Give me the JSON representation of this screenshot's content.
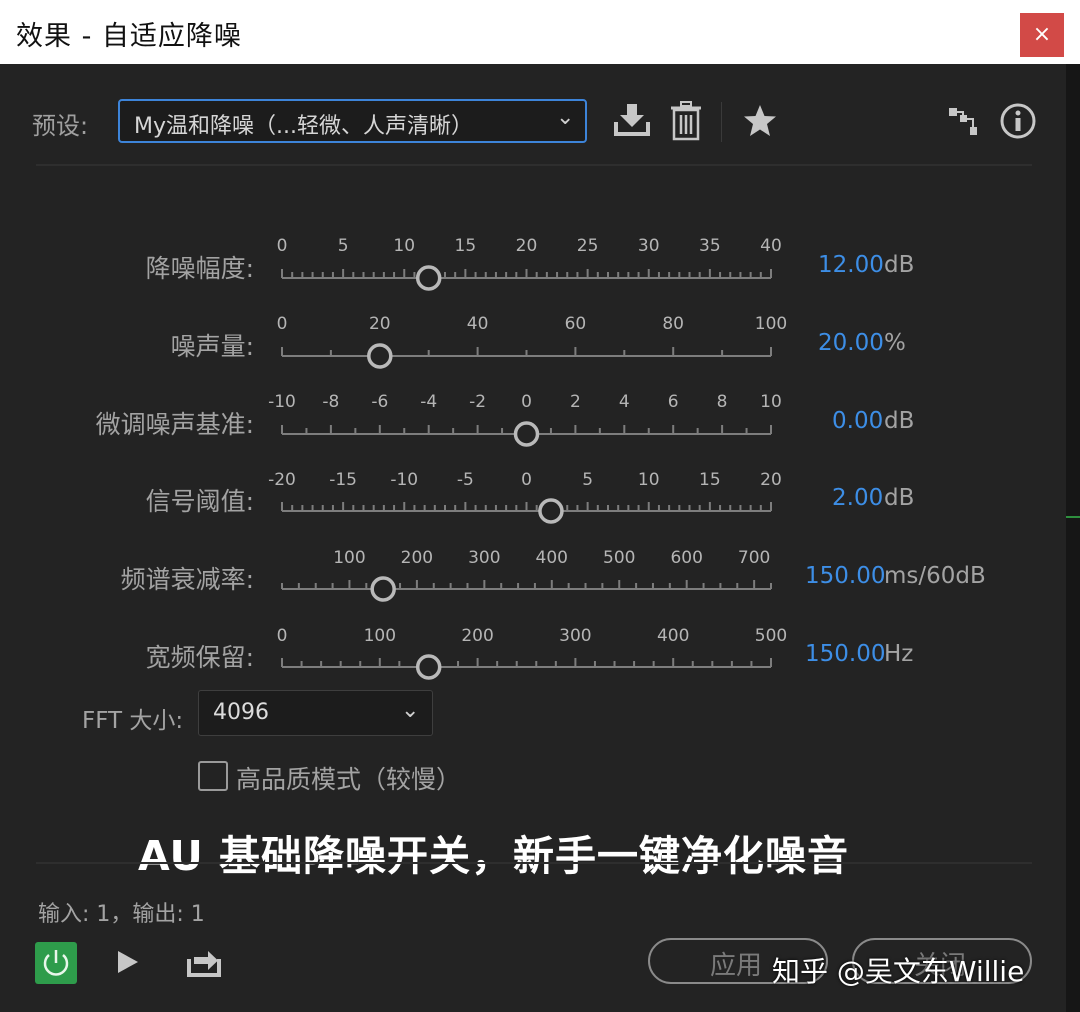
{
  "window": {
    "title": "效果 - 自适应降噪",
    "close_glyph": "×"
  },
  "preset": {
    "label": "预设:",
    "value": "My温和降噪（...轻微、人声清晰）"
  },
  "toolbar": {
    "icons": [
      "download-icon",
      "trash-icon",
      "star-icon",
      "routing-icon",
      "info-icon"
    ]
  },
  "sliders": [
    {
      "label": "降噪幅度:",
      "ticks": [
        "0",
        "5",
        "10",
        "15",
        "20",
        "25",
        "30",
        "35",
        "40"
      ],
      "min": 0,
      "max": 40,
      "value": 12,
      "display": "12.00",
      "unit": "dB",
      "minor_per_major": 5
    },
    {
      "label": "噪声量:",
      "ticks": [
        "0",
        "20",
        "40",
        "60",
        "80",
        "100"
      ],
      "min": 0,
      "max": 100,
      "value": 20,
      "display": "20.00",
      "unit": "%",
      "minor_per_major": 1
    },
    {
      "label": "微调噪声基准:",
      "ticks": [
        "-10",
        "-8",
        "-6",
        "-4",
        "-2",
        "0",
        "2",
        "4",
        "6",
        "8",
        "10"
      ],
      "min": -10,
      "max": 10,
      "value": 0,
      "display": "0.00",
      "unit": "dB",
      "minor_per_major": 1
    },
    {
      "label": "信号阈值:",
      "ticks": [
        "-20",
        "-15",
        "-10",
        "-5",
        "0",
        "5",
        "10",
        "15",
        "20"
      ],
      "min": -20,
      "max": 20,
      "value": 2,
      "display": "2.00",
      "unit": "dB",
      "minor_per_major": 5
    },
    {
      "label": "频谱衰减率:",
      "ticks": [
        "100",
        "200",
        "300",
        "400",
        "500",
        "600",
        "700"
      ],
      "tick_values": [
        100,
        200,
        300,
        400,
        500,
        600,
        700
      ],
      "min": 0,
      "max": 725,
      "value": 150,
      "display": "150.00",
      "unit": "ms/60dB",
      "minor_per_major": 3
    },
    {
      "label": "宽频保留:",
      "ticks": [
        "0",
        "100",
        "200",
        "300",
        "400",
        "500"
      ],
      "min": 0,
      "max": 500,
      "value": 150,
      "display": "150.00",
      "unit": "Hz",
      "minor_per_major": 4
    }
  ],
  "fft": {
    "label": "FFT 大小:",
    "value": "4096"
  },
  "high_quality": {
    "label": "高品质模式（较慢）",
    "checked": false
  },
  "subtitle": "AU 基础降噪开关，新手一键净化噪音",
  "io": "输入: 1，输出: 1",
  "buttons": {
    "apply": "应用",
    "close": "关闭"
  },
  "watermark": "知乎 @吴文东Willie",
  "colors": {
    "accent": "#3d8ee6",
    "power": "#2e9c4b",
    "close": "#d24a47"
  }
}
